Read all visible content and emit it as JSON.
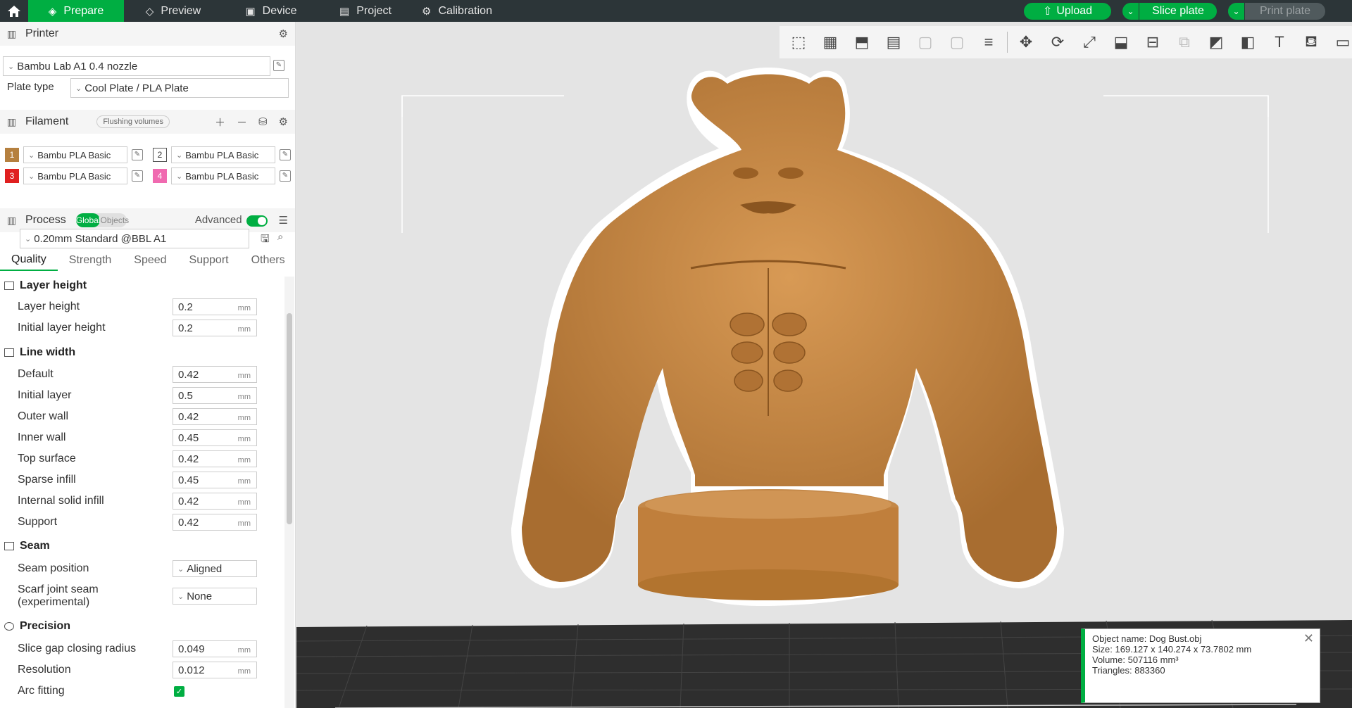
{
  "topbar": {
    "tabs": [
      {
        "label": "Prepare",
        "icon": "cube-icon"
      },
      {
        "label": "Preview",
        "icon": "layers-icon"
      },
      {
        "label": "Device",
        "icon": "device-icon"
      },
      {
        "label": "Project",
        "icon": "project-icon"
      },
      {
        "label": "Calibration",
        "icon": "calibration-icon"
      }
    ],
    "upload_label": "Upload",
    "slice_label": "Slice plate",
    "print_label": "Print plate"
  },
  "printer": {
    "title": "Printer",
    "name": "Bambu Lab A1 0.4 nozzle",
    "plate_type_label": "Plate type",
    "plate_type": "Cool Plate / PLA Plate"
  },
  "filament": {
    "title": "Filament",
    "flushing_label": "Flushing volumes",
    "items": [
      {
        "num": "1",
        "name": "Bambu PLA Basic",
        "color": "#b5803f"
      },
      {
        "num": "2",
        "name": "Bambu PLA Basic",
        "color": "#ffffff"
      },
      {
        "num": "3",
        "name": "Bambu PLA Basic",
        "color": "#e02020"
      },
      {
        "num": "4",
        "name": "Bambu PLA Basic",
        "color": "#f06ab0"
      }
    ]
  },
  "process": {
    "title": "Process",
    "toggle_global": "Global",
    "toggle_objects": "Objects",
    "advanced_label": "Advanced",
    "preset": "0.20mm Standard @BBL A1",
    "tabs": [
      "Quality",
      "Strength",
      "Speed",
      "Support",
      "Others"
    ]
  },
  "settings": {
    "layer_height_group": "Layer height",
    "layer_height_label": "Layer height",
    "layer_height": "0.2",
    "initial_layer_height_label": "Initial layer height",
    "initial_layer_height": "0.2",
    "line_width_group": "Line width",
    "lw_default_label": "Default",
    "lw_default": "0.42",
    "lw_initial_label": "Initial layer",
    "lw_initial": "0.5",
    "lw_outer_label": "Outer wall",
    "lw_outer": "0.42",
    "lw_inner_label": "Inner wall",
    "lw_inner": "0.45",
    "lw_top_label": "Top surface",
    "lw_top": "0.42",
    "lw_sparse_label": "Sparse infill",
    "lw_sparse": "0.45",
    "lw_internal_label": "Internal solid infill",
    "lw_internal": "0.42",
    "lw_support_label": "Support",
    "lw_support": "0.42",
    "seam_group": "Seam",
    "seam_position_label": "Seam position",
    "seam_position": "Aligned",
    "scarf_label_1": "Scarf joint seam",
    "scarf_label_2": "(experimental)",
    "scarf": "None",
    "precision_group": "Precision",
    "slice_gap_label": "Slice gap closing radius",
    "slice_gap": "0.049",
    "resolution_label": "Resolution",
    "resolution": "0.012",
    "arc_fitting_label": "Arc fitting",
    "unit": "mm"
  },
  "object_info": {
    "name": "Object name: Dog Bust.obj",
    "size": "Size: 169.127 x 140.274 x 73.7802 mm",
    "volume": "Volume: 507116 mm³",
    "triangles": "Triangles: 883360"
  },
  "colors": {
    "accent": "#00ae42",
    "topbar": "#2c3538",
    "model": "#c88a45"
  }
}
